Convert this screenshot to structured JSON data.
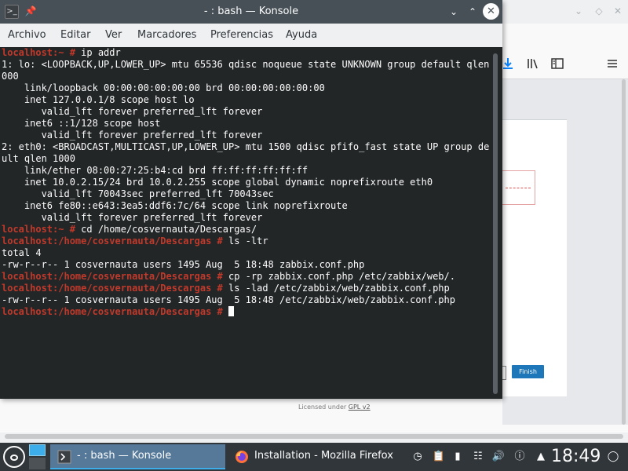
{
  "konsole": {
    "title": "- : bash — Konsole",
    "menu": [
      "Archivo",
      "Editar",
      "Ver",
      "Marcadores",
      "Preferencias",
      "Ayuda"
    ],
    "lines": [
      {
        "prompt": "localhost:~ #",
        "text": " ip addr"
      },
      {
        "prompt": "",
        "text": "1: lo: <LOOPBACK,UP,LOWER_UP> mtu 65536 qdisc noqueue state UNKNOWN group default qlen 1"
      },
      {
        "prompt": "",
        "text": "000"
      },
      {
        "prompt": "",
        "text": "    link/loopback 00:00:00:00:00:00 brd 00:00:00:00:00:00"
      },
      {
        "prompt": "",
        "text": "    inet 127.0.0.1/8 scope host lo"
      },
      {
        "prompt": "",
        "text": "       valid_lft forever preferred_lft forever"
      },
      {
        "prompt": "",
        "text": "    inet6 ::1/128 scope host"
      },
      {
        "prompt": "",
        "text": "       valid_lft forever preferred_lft forever"
      },
      {
        "prompt": "",
        "text": "2: eth0: <BROADCAST,MULTICAST,UP,LOWER_UP> mtu 1500 qdisc pfifo_fast state UP group defa"
      },
      {
        "prompt": "",
        "text": "ult qlen 1000"
      },
      {
        "prompt": "",
        "text": "    link/ether 08:00:27:25:b4:cd brd ff:ff:ff:ff:ff:ff"
      },
      {
        "prompt": "",
        "text": "    inet 10.0.2.15/24 brd 10.0.2.255 scope global dynamic noprefixroute eth0"
      },
      {
        "prompt": "",
        "text": "       valid_lft 70043sec preferred_lft 70043sec"
      },
      {
        "prompt": "",
        "text": "    inet6 fe80::e643:3ea5:ddf6:7c/64 scope link noprefixroute"
      },
      {
        "prompt": "",
        "text": "       valid_lft forever preferred_lft forever"
      },
      {
        "prompt": "localhost:~ #",
        "text": " cd /home/cosvernauta/Descargas/"
      },
      {
        "prompt": "localhost:/home/cosvernauta/Descargas #",
        "text": " ls -ltr"
      },
      {
        "prompt": "",
        "text": "total 4"
      },
      {
        "prompt": "",
        "text": "-rw-r--r-- 1 cosvernauta users 1495 Aug  5 18:48 zabbix.conf.php"
      },
      {
        "prompt": "localhost:/home/cosvernauta/Descargas #",
        "text": " cp -rp zabbix.conf.php /etc/zabbix/web/."
      },
      {
        "prompt": "localhost:/home/cosvernauta/Descargas #",
        "text": " ls -lad /etc/zabbix/web/zabbix.conf.php"
      },
      {
        "prompt": "",
        "text": "-rw-r--r-- 1 cosvernauta users 1495 Aug  5 18:48 /etc/zabbix/web/zabbix.conf.php"
      },
      {
        "prompt": "localhost:/home/cosvernauta/Descargas #",
        "text": " ",
        "cursor": true
      }
    ]
  },
  "firefox": {
    "finish_label": "Finish",
    "license_prefix": "Licensed under ",
    "license_link": "GPL v2"
  },
  "taskbar": {
    "tasks": [
      {
        "label": "- : bash — Konsole",
        "active": true
      },
      {
        "label": "Installation - Mozilla Firefox",
        "active": false
      }
    ],
    "clock": "18:49"
  },
  "colors": {
    "prompt": "#c0392b",
    "terminal_bg": "#232627",
    "terminal_fg": "#fcfcfc",
    "accent": "#3daee9",
    "finish_button": "#1e77b8"
  }
}
